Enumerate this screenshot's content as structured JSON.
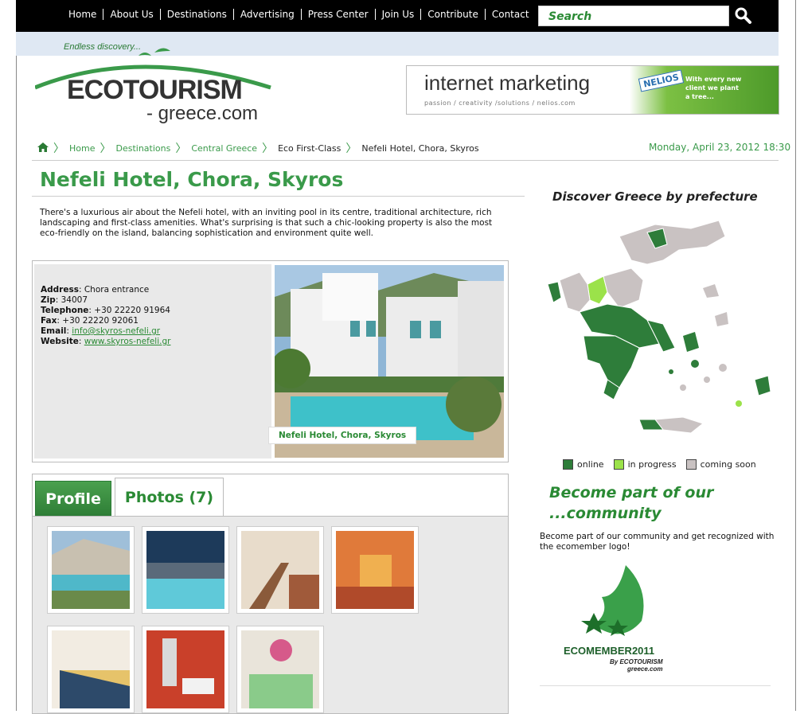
{
  "nav": {
    "items": [
      "Home",
      "About Us",
      "Destinations",
      "Advertising",
      "Press Center",
      "Join Us",
      "Contribute",
      "Contact"
    ],
    "search_placeholder": "Search"
  },
  "logo": {
    "tagline": "Endless discovery...",
    "name": "ECOTOURISM",
    "domain": "- greece.com"
  },
  "banner": {
    "title": "internet marketing",
    "subtitle": "passion / creativity /solutions / nelios.com",
    "brand": "NELIOS",
    "text_line1": "With every new",
    "text_line2": "client we plant",
    "text_line3": "a tree..."
  },
  "breadcrumb": {
    "home": "Home",
    "destinations": "Destinations",
    "region": "Central Greece",
    "category": "Eco First-Class",
    "current": "Nefeli Hotel, Chora, Skyros"
  },
  "datetime": "Monday, April 23, 2012 18:30",
  "page": {
    "title": "Nefeli Hotel, Chora, Skyros",
    "intro": "There's a luxurious air about the Nefeli hotel, with an inviting pool in its centre, traditional architecture, rich landscaping and first-class amenities. What's surprising is that such a chic-looking property is also the most eco-friendly on the island, balancing sophistication and environment quite well."
  },
  "contact": {
    "address_label": "Address",
    "address": ": Chora entrance",
    "zip_label": "Zip",
    "zip": ": 34007",
    "telephone_label": "Telephone",
    "telephone": ": +30 22220 91964",
    "fax_label": "Fax",
    "fax": ": +30 22220 92061",
    "email_label": "Email",
    "email": "info@skyros-nefeli.gr",
    "website_label": "Website",
    "website": "www.skyros-nefeli.gr"
  },
  "photo_caption": "Nefeli Hotel, Chora, Skyros",
  "tabs": {
    "profile": "Profile",
    "photos": "Photos (7)"
  },
  "sidebar": {
    "map_title": "Discover Greece by prefecture",
    "legend": {
      "online": "online",
      "in_progress": "in progress",
      "coming_soon": "coming soon"
    },
    "legend_colors": {
      "online": "#2e7d3a",
      "in_progress": "#9be24a",
      "coming_soon": "#c9c2c2"
    },
    "community_title_line1": "Become part of our",
    "community_title_line2": "...community",
    "community_text": "Become part of our community and get recognized with the ecomember logo!",
    "ecomember_label": "ECOMEMBER2011",
    "ecomember_by": "By ECOTOURISM",
    "ecomember_domain": "greece.com"
  }
}
